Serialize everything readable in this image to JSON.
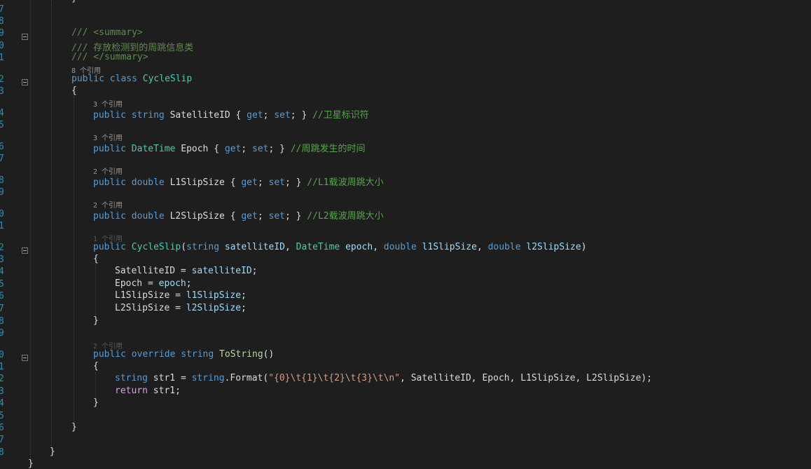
{
  "editor": {
    "line_numbers": [
      "7",
      "8",
      "9",
      "0",
      "1",
      "2",
      "3",
      "4",
      "5",
      "6",
      "7",
      "8",
      "9",
      "0",
      "1",
      "2",
      "3",
      "4",
      "5",
      "6",
      "7",
      "8",
      "9",
      "0",
      "1",
      "2",
      "3",
      "4",
      "5",
      "6",
      "7",
      "8"
    ],
    "codelens": {
      "class_refs": "8 个引用",
      "satelliteid_refs": "3 个引用",
      "epoch_refs": "3 个引用",
      "l1_refs": "2 个引用",
      "l2_refs": "2 个引用",
      "ctor_refs": "1 个引用",
      "tostring_refs": "2 个引用"
    },
    "tokens": {
      "brace_open": "{",
      "brace_close": "}",
      "doc_summary_open": "/// <summary>",
      "doc_summary_text": "/// 存放检测到的周跳信息类",
      "doc_summary_close": "/// </summary>",
      "kw_public": "public",
      "kw_class": "class",
      "class_name": "CycleSlip",
      "kw_string": "string",
      "type_datetime": "DateTime",
      "kw_double": "double",
      "kw_override": "override",
      "kw_return": "return",
      "prop_satelliteid": "SatelliteID",
      "prop_epoch": "Epoch",
      "prop_l1": "L1SlipSize",
      "prop_l2": "L2SlipSize",
      "accessor_open": "{",
      "kw_get": "get",
      "kw_set": "set",
      "accessor_sep": ";",
      "accessor_close": "; }",
      "comment_satelliteid": "//卫星标识符",
      "comment_epoch": "//周跳发生的时间",
      "comment_l1": "//L1载波周跳大小",
      "comment_l2": "//L2载波周跳大小",
      "param_satelliteid": "satelliteID",
      "param_epoch": "epoch",
      "param_l1": "l1SlipSize",
      "param_l2": "l2SlipSize",
      "paren_open": "(",
      "paren_close": ")",
      "comma": ",",
      "assign": "=",
      "semicolon": ";",
      "method_tostring": "ToString",
      "empty_parens": "()",
      "var_str1": "str1",
      "format_call": ".Format(",
      "string_literal_open": "\"",
      "fmt0": "{0}",
      "fmt1": "{1}",
      "fmt2": "{2}",
      "fmt3": "{3}",
      "escape_t": "\\t",
      "escape_n": "\\n",
      "string_literal_close": "\"",
      "format_args_tail": ", SatelliteID, Epoch, L1SlipSize, L2SlipSize);",
      "return_tail": " str1;"
    }
  }
}
